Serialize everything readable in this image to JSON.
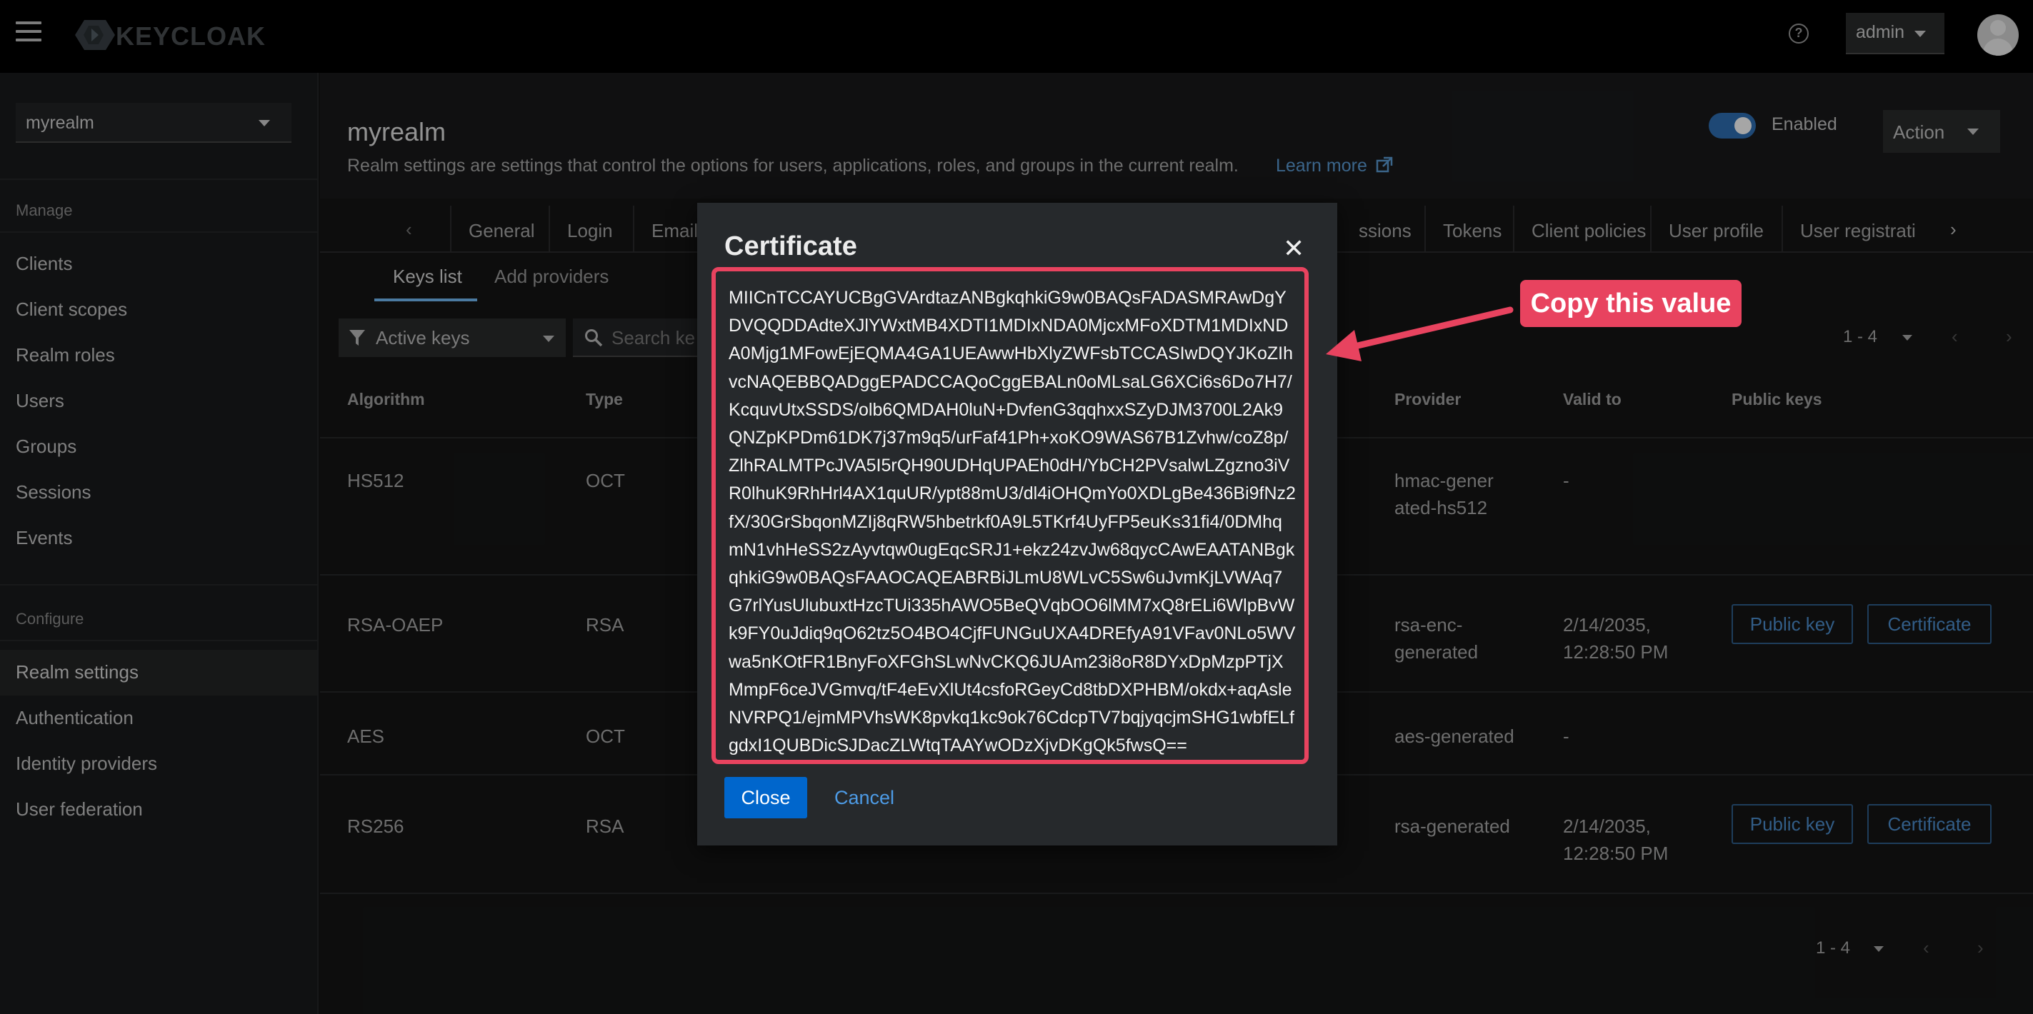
{
  "topbar": {
    "brand": "KEYCLOAK",
    "user_menu_label": "admin"
  },
  "sidebar": {
    "realm_selector": "myrealm",
    "manage_heading": "Manage",
    "manage_items": [
      "Clients",
      "Client scopes",
      "Realm roles",
      "Users",
      "Groups",
      "Sessions",
      "Events"
    ],
    "configure_heading": "Configure",
    "configure_items": [
      "Realm settings",
      "Authentication",
      "Identity providers",
      "User federation"
    ],
    "active_item": "Realm settings"
  },
  "header": {
    "title": "myrealm",
    "description": "Realm settings are settings that control the options for users, applications, roles, and groups in the current realm.",
    "learn_more": "Learn more",
    "enabled_label": "Enabled",
    "enabled": true,
    "action_label": "Action"
  },
  "tabs": [
    "General",
    "Login",
    "Email",
    "ssions",
    "Tokens",
    "Client policies",
    "User profile",
    "User registrati"
  ],
  "subtabs": [
    "Keys list",
    "Add providers"
  ],
  "toolbar": {
    "filter_label": "Active keys",
    "search_placeholder": "Search ke",
    "pagination": "1 - 4"
  },
  "table": {
    "headers": {
      "algorithm": "Algorithm",
      "type": "Type",
      "provider": "Provider",
      "valid_to": "Valid to",
      "public_keys": "Public keys"
    },
    "rows": [
      {
        "algorithm": "HS512",
        "type": "OCT",
        "provider": "hmac-generated-hs512",
        "valid_to": "-"
      },
      {
        "algorithm": "RSA-OAEP",
        "type": "RSA",
        "provider": "rsa-enc-generated",
        "valid_to": "2/14/2035, 12:28:50 PM",
        "public_key_btn": "Public key",
        "certificate_btn": "Certificate"
      },
      {
        "algorithm": "AES",
        "type": "OCT",
        "provider": "aes-generated",
        "valid_to": "-"
      },
      {
        "algorithm": "RS256",
        "type": "RSA",
        "provider": "rsa-generated",
        "valid_to": "2/14/2035, 12:28:50 PM",
        "public_key_btn": "Public key",
        "certificate_btn": "Certificate"
      }
    ]
  },
  "pagination_bottom": "1 - 4",
  "modal": {
    "title": "Certificate",
    "certificate": "MIICnTCCAYUCBgGVArdtazANBgkqhkiG9w0BAQsFADASMRAwDgYDVQQDDAdteXJlYWxtMB4XDTI1MDIxNDA0MjcxMFoXDTM1MDIxNDA0Mjg1MFowEjEQMA4GA1UEAwwHbXlyZWFsbTCCASIwDQYJKoZIhvcNAQEBBQADggEPADCCAQoCggEBALn0oMLsaLG6XCi6s6Do7H7/KcquvUtxSSDS/olb6QMDAH0luN+DvfenG3qqhxxSZyDJM3700L2Ak9QNZpKPDm61DK7j37m9q5/urFaf41Ph+xoKO9WAS67B1Zvhw/coZ8p/ZlhRALMTPcJVA5I5rQH90UDHqUPAEh0dH/YbCH2PVsalwLZgzno3iVR0lhuK9RhHrl4AX1quUR/ypt88mU3/dl4iOHQmYo0XDLgBe436Bi9fNz2fX/30GrSbqonMZIj8qRW5hbetrkf0A9L5TKrf4UyFP5euKs31fi4/0DMhqmN1vhHeSS2zAyvtqw0ugEqcSRJ1+ekz24zvJw68qycCAwEAATANBgkqhkiG9w0BAQsFAAOCAQEABRBiJLmU8WLvC5Sw6uJvmKjLVWAq7G7rlYusUlubuxtHzcTUi335hAWO5BeQVqbOO6lMM7xQ8rELi6WlpBvWk9FY0uJdiq9qO62tz5O4BO4CjfFUNGuUXA4DREfyA91VFav0NLo5WVwa5nKOtFR1BnyFoXFGhSLwNvCKQ6JUAm23i8oR8DYxDpMzpPTjXMmpF6ceJVGmvq/tF4eEvXlUt4csfoRGeyCd8tbDXPHBM/okdx+aqAsleNVRPQ1/ejmMPVhsWK8pvkq1kc9ok76CdcpTV7bqjyqcjmSHG1wbfELfgdxI1QUBDicSJDacZLWtqTAAYwODzXjvDKgQk5fwsQ==",
    "close_label": "Close",
    "cancel_label": "Cancel"
  },
  "annotation": {
    "label": "Copy this value",
    "color": "#e8435f"
  }
}
